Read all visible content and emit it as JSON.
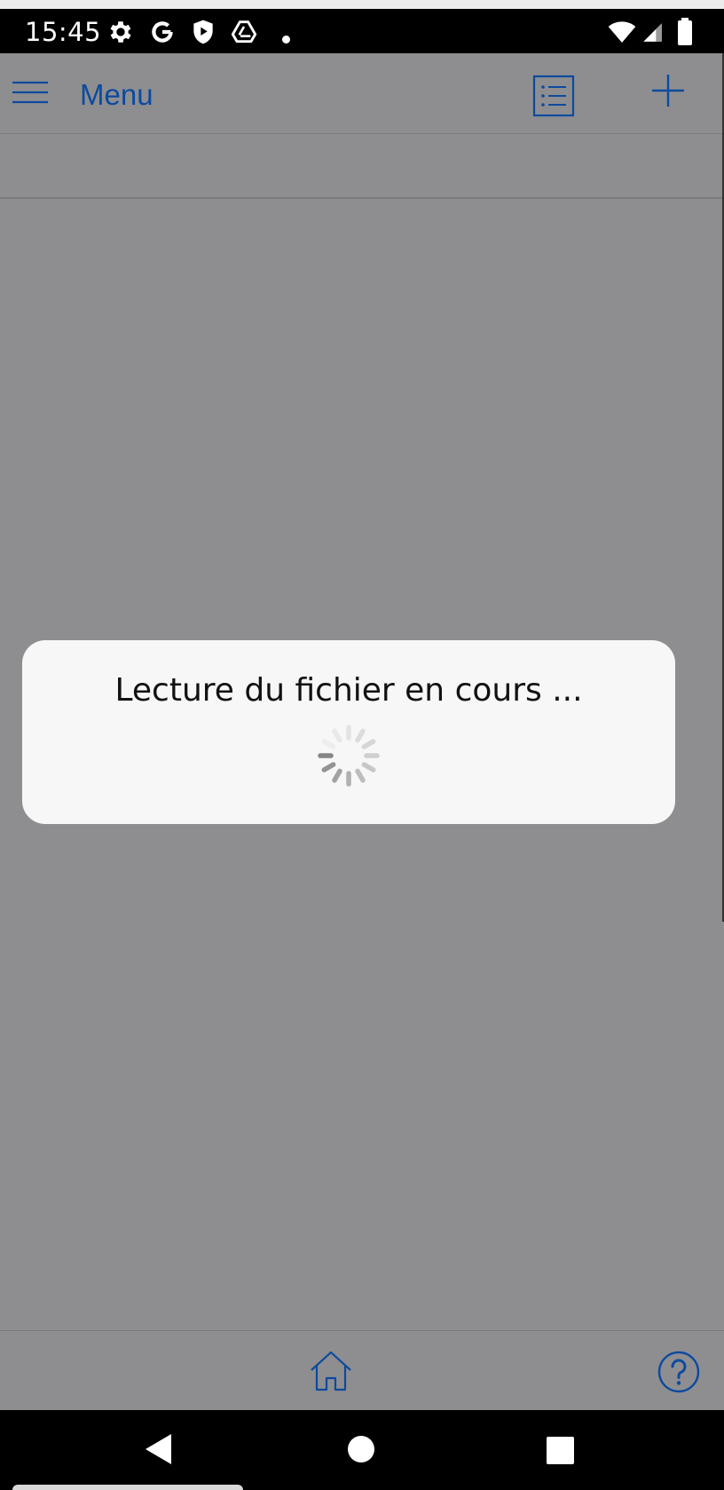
{
  "status_bar": {
    "time": "15:45",
    "icons": [
      "gear-icon",
      "google-icon",
      "shield-play-icon",
      "drive-icon",
      "notification-dot",
      "wifi-icon",
      "cell-signal-icon",
      "battery-icon"
    ]
  },
  "header": {
    "menu_label": "Menu",
    "icons": [
      "hamburger-icon",
      "list-icon",
      "plus-icon"
    ]
  },
  "dialog": {
    "message": "Lecture du fichier en cours ..."
  },
  "bottom_toolbar": {
    "icons": [
      "home-icon",
      "help-icon"
    ]
  },
  "nav_bar": {
    "icons": [
      "back-icon",
      "home-circle-icon",
      "recents-icon"
    ]
  },
  "colors": {
    "accent": "#0d4a9e",
    "overlay_background": "#8e8e90",
    "dialog_background": "#f7f7f7",
    "system_bars": "#000000"
  }
}
